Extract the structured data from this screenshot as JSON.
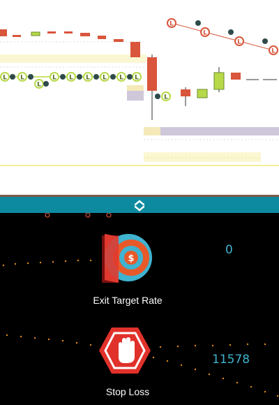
{
  "exit_target_rate": {
    "label": "Exit Target Rate",
    "value": "0",
    "icon": "exit-door-coin-icon"
  },
  "stop_loss": {
    "label": "Stop Loss",
    "value": "11578",
    "icon": "stop-hand-octagon-icon"
  },
  "divider": {
    "icon": "chevron-collapse-icon"
  },
  "markers": {
    "long_label": "L"
  },
  "colors": {
    "bear": "#d9553b",
    "bull": "#b7d949",
    "accent": "#0e8aa0",
    "value_text": "#3fb3cf",
    "dots": "#e08a1e"
  }
}
